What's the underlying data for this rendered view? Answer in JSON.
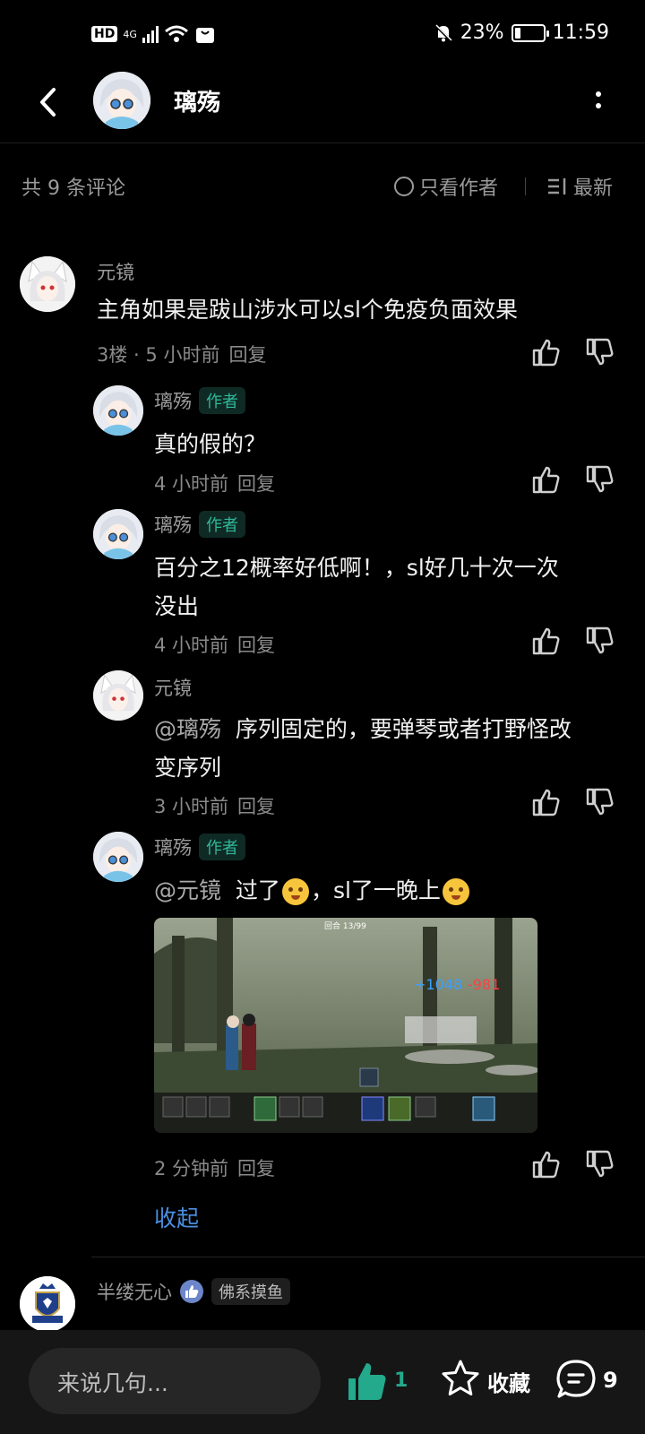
{
  "status_bar": {
    "left_badge": "HD",
    "network": "4G",
    "battery": "23%",
    "battery_level": 0.23,
    "time": "11:59"
  },
  "header": {
    "title": "璃殇"
  },
  "filter": {
    "total": "共 9 条评论",
    "only_author": "只看作者",
    "sort": "最新"
  },
  "comments": [
    {
      "user": "元镜",
      "text": "主角如果是跋山涉水可以sl个免疫负面效果",
      "floor": "3楼",
      "time": "5 小时前",
      "reply": "回复",
      "replies": [
        {
          "user": "璃殇",
          "tag": "作者",
          "text": "真的假的？",
          "time": "4 小时前",
          "reply": "回复"
        },
        {
          "user": "璃殇",
          "tag": "作者",
          "text_line1": "百分之12概率好低啊！，sl好几十次一次",
          "text_line2": "没出",
          "time": "4 小时前",
          "reply": "回复"
        },
        {
          "user": "元镜",
          "mention": "@璃殇",
          "text_line1": "序列固定的，要弹琴或者打野怪改",
          "text_line2": "变序列",
          "time": "3 小时前",
          "reply": "回复"
        },
        {
          "user": "璃殇",
          "tag": "作者",
          "mention": "@元镜",
          "text_a": "过了",
          "text_b": "，sl了一晚上",
          "time": "2 分钟前",
          "reply": "回复"
        }
      ],
      "collapse": "收起"
    },
    {
      "user": "半缕无心",
      "badge": "佛系摸鱼"
    }
  ],
  "bottom_bar": {
    "placeholder": "来说几句...",
    "like_count": "1",
    "favorite": "收藏",
    "comment_count": "9"
  },
  "game_image": {
    "round_label": "回合 13/99"
  },
  "colors": {
    "accent_teal": "#23a98b",
    "link_blue": "#4a8fe0",
    "background": "#000000"
  },
  "icons": [
    "back-arrow-icon",
    "more-vertical-icon",
    "circle-radio-icon",
    "sort-lines-icon",
    "thumb-up-icon",
    "thumb-down-icon",
    "star-icon",
    "comment-bubble-icon"
  ]
}
